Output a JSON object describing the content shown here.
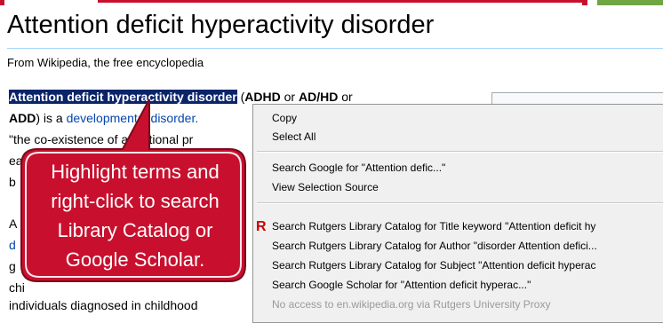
{
  "article": {
    "title": "Attention deficit hyperactivity disorder",
    "subtitle": "From Wikipedia, the free encyclopedia",
    "lines": {
      "l1_selected": "Attention deficit hyperactivity disorder",
      "l1_rest_a": " (",
      "l1_adhd": "ADHD",
      "l1_or1": " or ",
      "l1_adhd2": "AD/HD",
      "l1_or2": " or",
      "l2_add": "ADD",
      "l2_text": ") is a ",
      "l2_link": "developmental disorder.",
      "l3": "\"the co-existence of attentional pr",
      "l4": "ea",
      "l5": "b",
      "l6": "A",
      "l7": "d",
      "l8": "g",
      "l9": "chi",
      "l10": "individuals diagnosed in childhood"
    }
  },
  "context_menu": {
    "copy": "Copy",
    "select_all": "Select All",
    "search_google": "Search Google for \"Attention defic...\"",
    "view_source": "View Selection Source",
    "rutgers_icon": "R",
    "rutgers_title": "Search Rutgers Library Catalog for Title keyword \"Attention deficit hy",
    "rutgers_author": "Search Rutgers Library Catalog for Author \"disorder Attention defici...",
    "rutgers_subject": "Search Rutgers Library Catalog for Subject \"Attention deficit hyperac",
    "google_scholar": "Search Google Scholar for \"Attention deficit hyperac...\"",
    "proxy_note": "No access to en.wikipedia.org via Rutgers University Proxy"
  },
  "callout": {
    "line1": "Highlight terms and",
    "line2": "right-click to search",
    "line3": "Library Catalog or",
    "line4": "Google Scholar."
  },
  "colors": {
    "selection": "#0a246a",
    "callout_fill": "#c8102e",
    "link": "#0645ad",
    "rutgers_red": "#cc0000"
  }
}
